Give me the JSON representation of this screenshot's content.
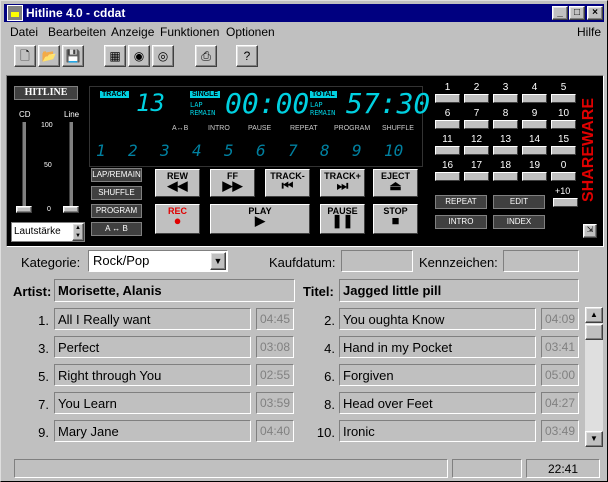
{
  "window": {
    "title": "Hitline 4.0 - cddat",
    "min": "_",
    "max": "□",
    "close": "×"
  },
  "menu": {
    "items": [
      "Datei",
      "Bearbeiten",
      "Anzeige",
      "Funktionen",
      "Optionen"
    ],
    "help": "Hilfe"
  },
  "player": {
    "logo": "HITLINE",
    "cd_label": "CD",
    "line_label": "Line",
    "scale_top": "100",
    "scale_mid": "50",
    "scale_bot": "0",
    "volume_label": "Lautstärke",
    "track_tag": "TRACK",
    "track_num": "13",
    "single_tag": "SINGLE",
    "lap_tag": "LAP",
    "remain_tag": "REMAIN",
    "time": "00:00",
    "total_tag": "TOTAL",
    "total_lap": "LAP",
    "total_remain": "REMAIN",
    "total_time": "57:30",
    "indicators": [
      "A↔B",
      "INTRO",
      "PAUSE",
      "REPEAT",
      "PROGRAM",
      "SHUFFLE"
    ],
    "track_digits": [
      "1",
      "2",
      "3",
      "4",
      "5",
      "6",
      "7",
      "8",
      "9",
      "10"
    ],
    "mode_buttons": [
      "LAP/REMAIN",
      "SHUFFLE",
      "PROGRAM",
      "A ↔ B"
    ],
    "transport": {
      "rew": "REW",
      "ff": "FF",
      "track_prev": "TRACK-",
      "track_next": "TRACK+",
      "eject": "EJECT",
      "rec": "REC",
      "play": "PLAY",
      "pause": "PAUSE",
      "stop": "STOP"
    },
    "num_labels": [
      "1",
      "2",
      "3",
      "4",
      "5",
      "6",
      "7",
      "8",
      "9",
      "10",
      "11",
      "12",
      "13",
      "14",
      "15",
      "16",
      "17",
      "18",
      "19",
      "0"
    ],
    "plus10": "+10",
    "func_buttons": [
      "REPEAT",
      "EDIT",
      "INTRO",
      "INDEX"
    ],
    "shareware": "SHAREWARE"
  },
  "form": {
    "kategorie_label": "Kategorie:",
    "kategorie_value": "Rock/Pop",
    "kaufdatum_label": "Kaufdatum:",
    "kaufdatum_value": "",
    "kennzeichen_label": "Kennzeichen:",
    "kennzeichen_value": "",
    "artist_label": "Artist:",
    "artist_value": "Morisette, Alanis",
    "titel_label": "Titel:",
    "titel_value": "Jagged little pill"
  },
  "tracks_left": [
    {
      "no": "1.",
      "title": "All I Really want",
      "dur": "04:45"
    },
    {
      "no": "3.",
      "title": "Perfect",
      "dur": "03:08"
    },
    {
      "no": "5.",
      "title": "Right through You",
      "dur": "02:55"
    },
    {
      "no": "7.",
      "title": "You Learn",
      "dur": "03:59"
    },
    {
      "no": "9.",
      "title": "Mary Jane",
      "dur": "04:40"
    }
  ],
  "tracks_right": [
    {
      "no": "2.",
      "title": "You oughta Know",
      "dur": "04:09"
    },
    {
      "no": "4.",
      "title": "Hand in my Pocket",
      "dur": "03:41"
    },
    {
      "no": "6.",
      "title": "Forgiven",
      "dur": "05:00"
    },
    {
      "no": "8.",
      "title": "Head over Feet",
      "dur": "04:27"
    },
    {
      "no": "10.",
      "title": "Ironic",
      "dur": "03:49"
    }
  ],
  "status": {
    "text": "",
    "clock": "22:41"
  },
  "colors": {
    "titlebar": "#000080",
    "lcd": "#00d0e0",
    "rec": "#e00000",
    "shareware": "#e00000"
  }
}
